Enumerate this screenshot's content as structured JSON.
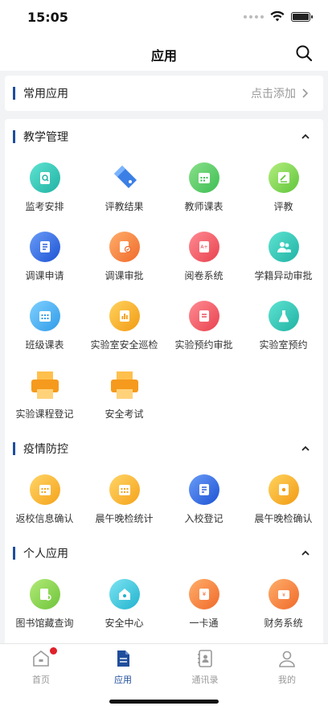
{
  "status": {
    "time": "15:05"
  },
  "header": {
    "title": "应用"
  },
  "common": {
    "title": "常用应用",
    "add_hint": "点击添加"
  },
  "sections": [
    {
      "title": "教学管理",
      "items": [
        {
          "label": "监考安排",
          "icon": "clipboard-search-icon"
        },
        {
          "label": "评教结果",
          "icon": "pen-tag-icon"
        },
        {
          "label": "教师课表",
          "icon": "calendar-grid-icon"
        },
        {
          "label": "评教",
          "icon": "edit-note-icon"
        },
        {
          "label": "调课申请",
          "icon": "book-edit-icon"
        },
        {
          "label": "调课审批",
          "icon": "doc-approve-icon"
        },
        {
          "label": "阅卷系统",
          "icon": "grade-paper-icon"
        },
        {
          "label": "学籍异动审批",
          "icon": "users-icon"
        },
        {
          "label": "班级课表",
          "icon": "class-calendar-icon"
        },
        {
          "label": "实验室安全巡检",
          "icon": "bar-report-icon"
        },
        {
          "label": "实验预约审批",
          "icon": "document-icon"
        },
        {
          "label": "实验室预约",
          "icon": "flask-icon"
        },
        {
          "label": "实验课程登记",
          "icon": "printer-icon"
        },
        {
          "label": "安全考试",
          "icon": "printer-icon"
        }
      ]
    },
    {
      "title": "疫情防控",
      "items": [
        {
          "label": "返校信息确认",
          "icon": "calendar-check-icon"
        },
        {
          "label": "晨午晚检统计",
          "icon": "calendar-stats-icon"
        },
        {
          "label": "入校登记",
          "icon": "register-icon"
        },
        {
          "label": "晨午晚检确认",
          "icon": "report-icon"
        }
      ]
    },
    {
      "title": "个人应用",
      "items": [
        {
          "label": "图书馆藏查询",
          "icon": "library-icon"
        },
        {
          "label": "安全中心",
          "icon": "home-shield-icon"
        },
        {
          "label": "一卡通",
          "icon": "card-icon"
        },
        {
          "label": "财务系统",
          "icon": "wallet-icon"
        }
      ]
    }
  ],
  "tabbar": [
    {
      "label": "首页",
      "icon": "home-icon"
    },
    {
      "label": "应用",
      "icon": "apps-doc-icon"
    },
    {
      "label": "通讯录",
      "icon": "contacts-icon"
    },
    {
      "label": "我的",
      "icon": "person-icon"
    }
  ],
  "colors": {
    "accent": "#1f4e9c",
    "badge": "#e0202a"
  }
}
